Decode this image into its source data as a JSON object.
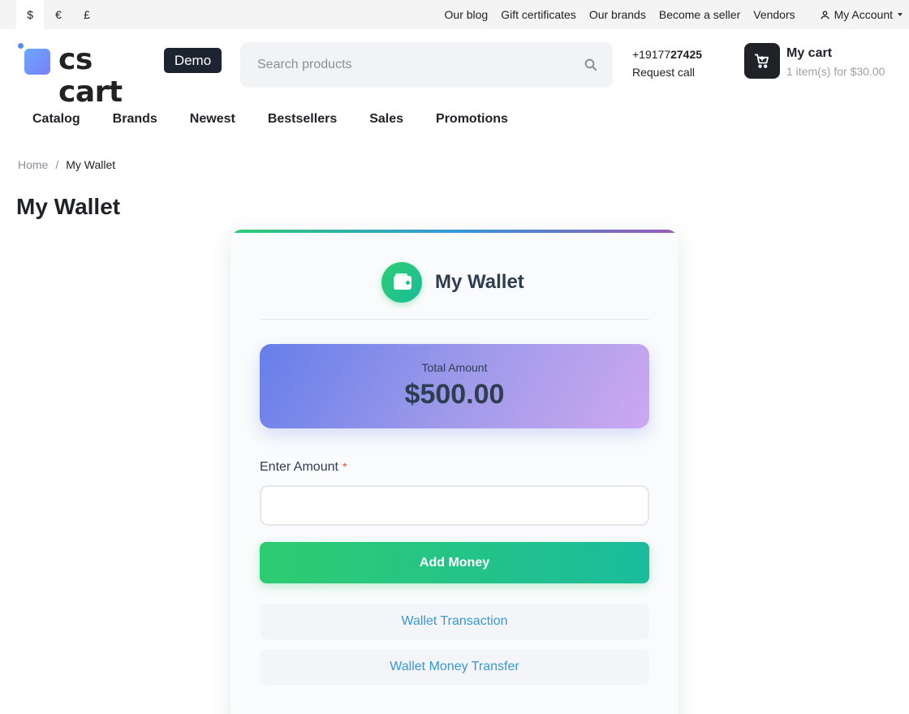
{
  "topbar": {
    "currencies": [
      "$",
      "€",
      "£"
    ],
    "active_currency": "$",
    "links": [
      "Our blog",
      "Gift certificates",
      "Our brands",
      "Become a seller",
      "Vendors"
    ],
    "account_label": "My Account"
  },
  "header": {
    "logo_text": "cs cart",
    "badge": "Demo",
    "search_placeholder": "Search products",
    "phone_prefix": "+19177",
    "phone_bold": "27425",
    "request_call": "Request call",
    "cart_title": "My cart",
    "cart_summary": "1 item(s) for $30.00"
  },
  "nav": {
    "items": [
      "Catalog",
      "Brands",
      "Newest",
      "Bestsellers",
      "Sales",
      "Promotions"
    ]
  },
  "breadcrumb": {
    "home": "Home",
    "separator": "/",
    "current": "My Wallet"
  },
  "page_title": "My Wallet",
  "wallet": {
    "title": "My Wallet",
    "total_label": "Total Amount",
    "total_value": "$500.00",
    "amount_label": "Enter Amount",
    "required_mark": "*",
    "amount_value": "",
    "add_button": "Add Money",
    "links": [
      "Wallet Transaction",
      "Wallet Money Transfer"
    ],
    "colors": {
      "accent_green": "#2ecc71",
      "accent_teal": "#1abc9c",
      "link_blue": "#3498db",
      "balance_gradient_start": "#667eea",
      "balance_gradient_end": "#cda8f0",
      "required_red": "#e74c3c"
    }
  },
  "icons": {
    "search": "search-icon",
    "cart": "cart-icon",
    "account": "user-icon",
    "wallet": "wallet-icon"
  }
}
